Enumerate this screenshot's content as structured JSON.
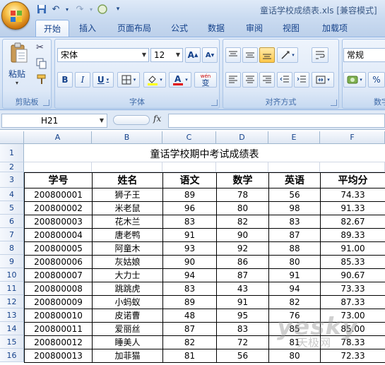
{
  "window": {
    "title": "童话学校成绩表.xls  [兼容模式]"
  },
  "qat": [
    {
      "icon": "save-icon",
      "glyph": "💾"
    },
    {
      "icon": "undo-icon",
      "glyph": "↶"
    },
    {
      "icon": "redo-icon",
      "glyph": "↷"
    },
    {
      "icon": "circle-icon",
      "glyph": "○"
    },
    {
      "icon": "customize-icon",
      "glyph": "▾"
    }
  ],
  "tabs": [
    {
      "label": "开始",
      "active": true
    },
    {
      "label": "插入"
    },
    {
      "label": "页面布局"
    },
    {
      "label": "公式"
    },
    {
      "label": "数据"
    },
    {
      "label": "审阅"
    },
    {
      "label": "视图"
    },
    {
      "label": "加载项"
    }
  ],
  "ribbon": {
    "clipboard": {
      "label": "剪贴板",
      "paste": "粘贴"
    },
    "font": {
      "label": "字体",
      "name": "宋体",
      "size": "12",
      "bold": "B",
      "italic": "I",
      "underline": "U",
      "grow": "A",
      "shrink": "A",
      "wen": "wén",
      "wen2": "变"
    },
    "align": {
      "label": "对齐方式"
    },
    "number": {
      "label": "数字",
      "format": "常规",
      "percent": "%"
    }
  },
  "formula_bar": {
    "name_box": "H21",
    "fx": "fx",
    "value": ""
  },
  "columns": [
    "A",
    "B",
    "C",
    "D",
    "E",
    "F"
  ],
  "rows": [
    "1",
    "2",
    "3",
    "4",
    "5",
    "6",
    "7",
    "8",
    "9",
    "10",
    "11",
    "12",
    "13",
    "14",
    "15",
    "16"
  ],
  "sheet": {
    "title": "童话学校期中考试成绩表",
    "headers": [
      "学号",
      "姓名",
      "语文",
      "数学",
      "英语",
      "平均分"
    ],
    "records": [
      [
        "200800001",
        "狮子王",
        "89",
        "78",
        "56",
        "74.33"
      ],
      [
        "200800002",
        "米老鼠",
        "96",
        "80",
        "98",
        "91.33"
      ],
      [
        "200800003",
        "花木兰",
        "83",
        "82",
        "83",
        "82.67"
      ],
      [
        "200800004",
        "唐老鸭",
        "91",
        "90",
        "87",
        "89.33"
      ],
      [
        "200800005",
        "阿童木",
        "93",
        "92",
        "88",
        "91.00"
      ],
      [
        "200800006",
        "灰姑娘",
        "90",
        "86",
        "80",
        "85.33"
      ],
      [
        "200800007",
        "大力士",
        "94",
        "87",
        "91",
        "90.67"
      ],
      [
        "200800008",
        "跳跳虎",
        "83",
        "43",
        "94",
        "73.33"
      ],
      [
        "200800009",
        "小蚂蚁",
        "89",
        "91",
        "82",
        "87.33"
      ],
      [
        "200800010",
        "皮诺曹",
        "48",
        "95",
        "76",
        "73.00"
      ],
      [
        "200800011",
        "爱丽丝",
        "87",
        "83",
        "85",
        "85.00"
      ],
      [
        "200800012",
        "睡美人",
        "82",
        "72",
        "81",
        "78.33"
      ],
      [
        "200800013",
        "加菲猫",
        "81",
        "56",
        "80",
        "72.33"
      ]
    ]
  },
  "watermark": {
    "brand": "yesky",
    "sub": "天极网"
  }
}
